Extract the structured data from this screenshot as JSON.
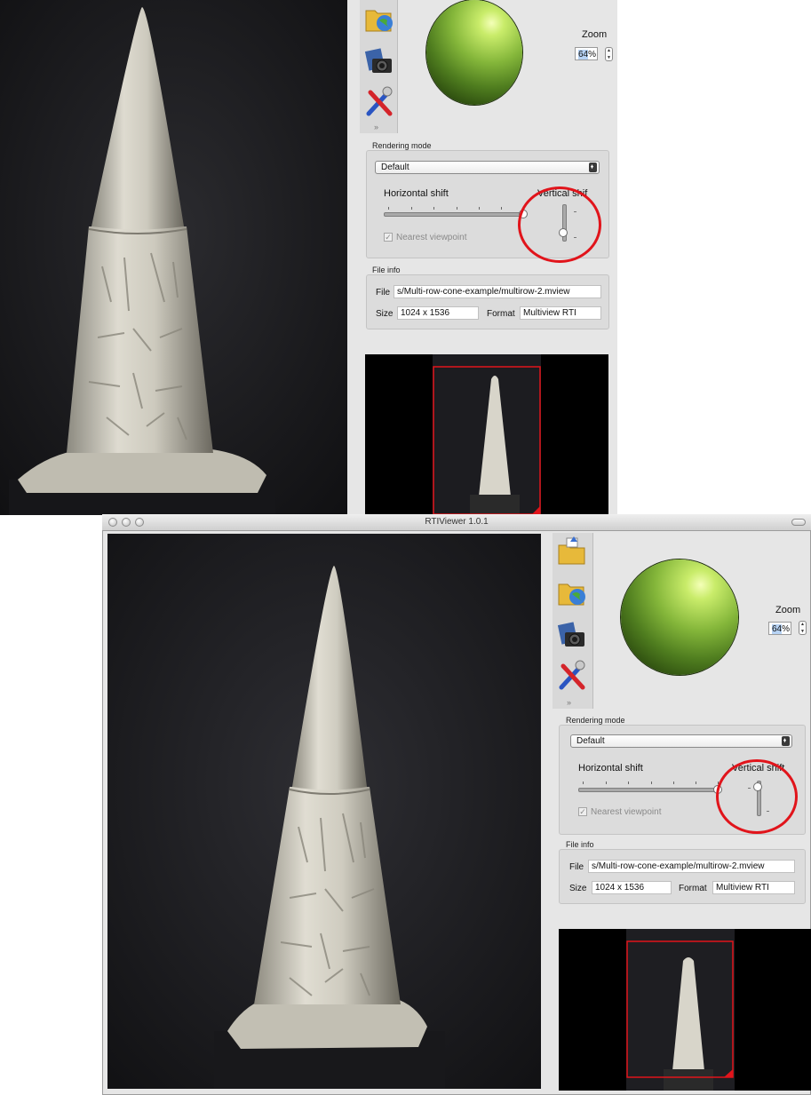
{
  "window": {
    "title": "RTIViewer 1.0.1"
  },
  "zoom": {
    "label": "Zoom",
    "value_selected": "64",
    "value_suffix": "%"
  },
  "rendering": {
    "group_label": "Rendering mode",
    "mode": "Default",
    "horizontal_shift_label": "Horizontal shift",
    "vertical_shift_label": "Vertical shift",
    "vertical_shift_label_clipped": "Vertical shif",
    "nearest_viewpoint_label": "Nearest viewpoint",
    "nearest_viewpoint_checked": true
  },
  "file_info": {
    "group_label": "File info",
    "file_label": "File",
    "file_value": "s/Multi-row-cone-example/multirow-2.mview",
    "size_label": "Size",
    "size_value": "1024 x 1536",
    "format_label": "Format",
    "format_value": "Multiview RTI"
  },
  "icons": {
    "toolbar": [
      "open-folder-icon",
      "open-web-folder-icon",
      "snapshot-camera-icon",
      "settings-tools-icon"
    ],
    "more": "chevron-double-down-icon"
  },
  "colors": {
    "highlight_circle": "#e1141b",
    "sphere": "#84b63a",
    "minimap_frame": "#e1141b"
  }
}
